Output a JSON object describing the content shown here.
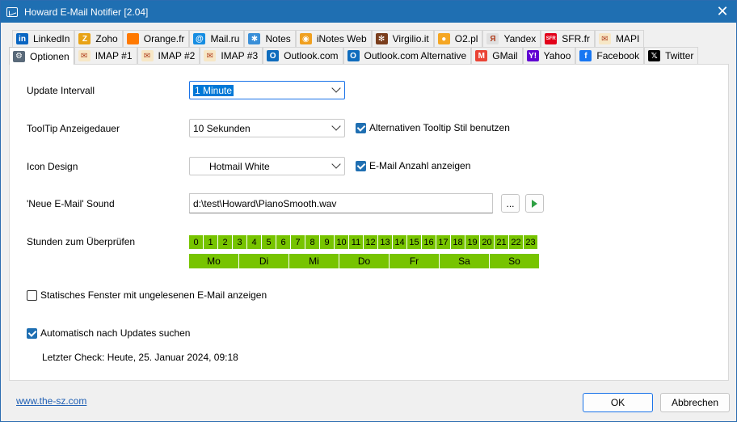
{
  "window": {
    "title": "Howard E-Mail Notifier [2.04]"
  },
  "tabs_row1": [
    {
      "label": "LinkedIn",
      "icon": "linkedin-icon",
      "color": "#0a66c2",
      "glyph": "in"
    },
    {
      "label": "Zoho",
      "icon": "zoho-icon",
      "color": "#e8a317",
      "glyph": "Z"
    },
    {
      "label": "Orange.fr",
      "icon": "orange-icon",
      "color": "#ff7900",
      "glyph": ""
    },
    {
      "label": "Mail.ru",
      "icon": "mailru-icon",
      "color": "#168de2",
      "glyph": "@"
    },
    {
      "label": "Notes",
      "icon": "notes-icon",
      "color": "#3a8fd8",
      "glyph": "✱"
    },
    {
      "label": "iNotes Web",
      "icon": "inotes-icon",
      "color": "#f0a020",
      "glyph": "◉"
    },
    {
      "label": "Virgilio.it",
      "icon": "virgilio-icon",
      "color": "#7a3e1d",
      "glyph": "✻"
    },
    {
      "label": "O2.pl",
      "icon": "o2-icon",
      "color": "#f5a623",
      "glyph": "●"
    },
    {
      "label": "Yandex",
      "icon": "yandex-icon",
      "color": "#e0e0e0",
      "glyph": "Я"
    },
    {
      "label": "SFR.fr",
      "icon": "sfr-icon",
      "color": "#e2001a",
      "glyph": "SFR"
    },
    {
      "label": "MAPI",
      "icon": "mapi-envelope-icon",
      "color": "#f7e7c6",
      "glyph": "✉"
    }
  ],
  "tabs_row2": [
    {
      "label": "Optionen",
      "icon": "settings-gear-icon",
      "color": "#5a6a7a",
      "glyph": "⚙",
      "active": true
    },
    {
      "label": "IMAP #1",
      "icon": "imap-envelope-icon",
      "color": "#f7e7c6",
      "glyph": "✉"
    },
    {
      "label": "IMAP #2",
      "icon": "imap-envelope-icon",
      "color": "#f7e7c6",
      "glyph": "✉"
    },
    {
      "label": "IMAP #3",
      "icon": "imap-envelope-icon",
      "color": "#f7e7c6",
      "glyph": "✉"
    },
    {
      "label": "Outlook.com",
      "icon": "outlook-icon",
      "color": "#0f6cbd",
      "glyph": "O"
    },
    {
      "label": "Outlook.com Alternative",
      "icon": "outlook-icon",
      "color": "#0f6cbd",
      "glyph": "O"
    },
    {
      "label": "GMail",
      "icon": "gmail-icon",
      "color": "#ea4335",
      "glyph": "M"
    },
    {
      "label": "Yahoo",
      "icon": "yahoo-icon",
      "color": "#6001d2",
      "glyph": "Y!"
    },
    {
      "label": "Facebook",
      "icon": "facebook-icon",
      "color": "#1877f2",
      "glyph": "f"
    },
    {
      "label": "Twitter",
      "icon": "x-twitter-icon",
      "color": "#000000",
      "glyph": "𝕏"
    }
  ],
  "options": {
    "update_label": "Update Intervall",
    "update_value": "1 Minute",
    "tooltip_label": "ToolTip Anzeigedauer",
    "tooltip_value": "10 Sekunden",
    "tooltip_alt_label": "Alternativen Tooltip Stil benutzen",
    "icon_label": "Icon Design",
    "icon_value": "Hotmail White",
    "icon_count_label": "E-Mail Anzahl anzeigen",
    "sound_label": "'Neue E-Mail' Sound",
    "sound_value": "d:\\test\\Howard\\PianoSmooth.wav",
    "browse_label": "...",
    "hours_label": "Stunden zum Überprüfen",
    "hours": [
      "0",
      "1",
      "2",
      "3",
      "4",
      "5",
      "6",
      "7",
      "8",
      "9",
      "10",
      "11",
      "12",
      "13",
      "14",
      "15",
      "16",
      "17",
      "18",
      "19",
      "20",
      "21",
      "22",
      "23"
    ],
    "days": [
      "Mo",
      "Di",
      "Mi",
      "Do",
      "Fr",
      "Sa",
      "So"
    ],
    "static_window_label": "Statisches Fenster mit ungelesenen E-Mail anzeigen",
    "auto_update_label": "Automatisch nach Updates suchen",
    "last_check": "Letzter Check: Heute, 25. Januar 2024, 09:18"
  },
  "footer": {
    "link": "www.the-sz.com",
    "ok": "OK",
    "cancel": "Abbrechen"
  },
  "colors": {
    "accent": "#1f6fb2",
    "hour_active": "#77c400"
  }
}
